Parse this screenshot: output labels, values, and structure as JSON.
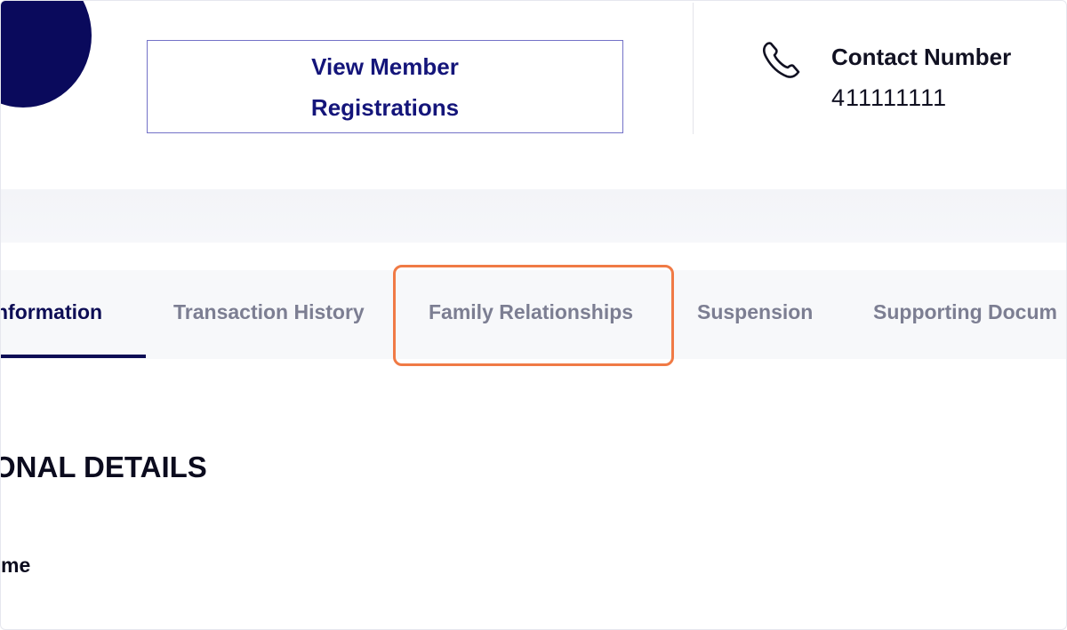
{
  "header": {
    "view_member_registrations": [
      "View Member",
      "Registrations"
    ],
    "contact": {
      "label": "Contact Number",
      "value": "411111111",
      "icon": "phone-icon"
    },
    "logo_icon": "logo-icon"
  },
  "tabs": [
    {
      "label": "nformation",
      "active": true
    },
    {
      "label": "Transaction History",
      "active": false
    },
    {
      "label": "Family Relationships",
      "active": false,
      "highlighted": true
    },
    {
      "label": "Suspension",
      "active": false
    },
    {
      "label": "Supporting Docum",
      "active": false
    }
  ],
  "main": {
    "section_title": "ONAL DETAILS",
    "field_label": "me"
  },
  "colors": {
    "brand_navy": "#0a0a5c",
    "button_text": "#14157a",
    "button_border": "#7472c7",
    "tab_inactive": "#7c7e92",
    "highlight": "#f07a45"
  }
}
